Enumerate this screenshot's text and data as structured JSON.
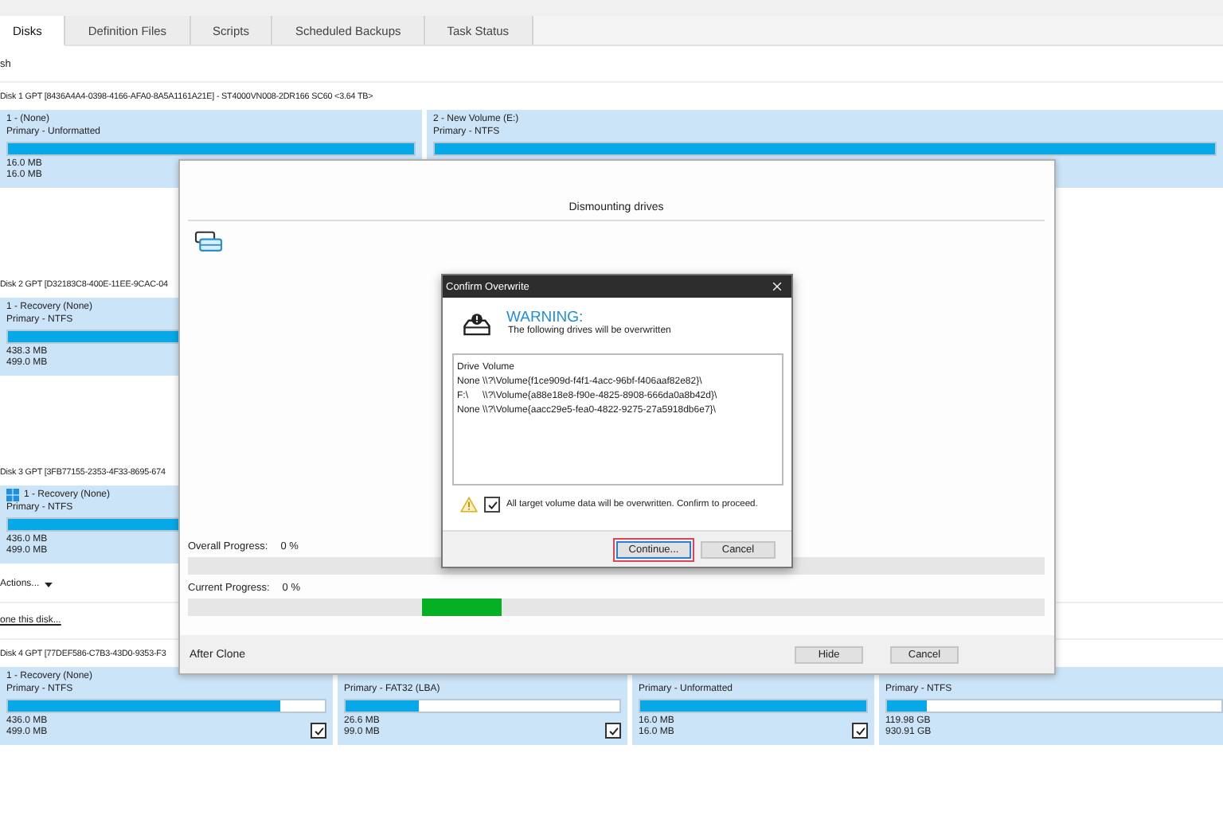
{
  "tabs": [
    {
      "label": "Disks",
      "selected": true
    },
    {
      "label": "Definition Files",
      "selected": false
    },
    {
      "label": "Scripts",
      "selected": false
    },
    {
      "label": "Scheduled Backups",
      "selected": false
    },
    {
      "label": "Task Status",
      "selected": false
    }
  ],
  "toolbar": {
    "refresh": "sh"
  },
  "disks": [
    {
      "header": "Disk 1 GPT [8436A4A4-0398-4166-AFA0-8A5A1161A21E] - ST4000VN008-2DR166 SC60  <3.64 TB>",
      "partitions": [
        {
          "name": "1 - (None)",
          "type": "Primary - Unformatted",
          "level": 1,
          "used": "16.0 MB",
          "total": "16.0 MB"
        },
        {
          "name": "2 - New Volume (E:)",
          "type": "Primary - NTFS",
          "level": 1
        }
      ]
    },
    {
      "header": "Disk 2 GPT [D32183C8-400E-11EE-9CAC-04",
      "partitions": [
        {
          "name": "1 - Recovery (None)",
          "type": "Primary - NTFS",
          "level": 0.88,
          "used": "438.3 MB",
          "total": "499.0 MB"
        }
      ]
    },
    {
      "header": "Disk 3 GPT [3FB77155-2353-4F33-8695-674",
      "partitions": [
        {
          "name": "1 - Recovery (None)",
          "system": true,
          "type": "Primary - NTFS",
          "level": 0.87,
          "used": "436.0 MB",
          "total": "499.0 MB"
        }
      ],
      "actions": "Actions...",
      "clone_link": "one this disk..."
    },
    {
      "header": "Disk 4 GPT [77DEF586-C7B3-43D0-9353-F3",
      "partitions": [
        {
          "name": "1 - Recovery (None)",
          "type": "Primary - NTFS",
          "level": 0.86,
          "used": "436.0 MB",
          "total": "499.0 MB",
          "checked": true
        },
        {
          "type": "Primary - FAT32 (LBA)",
          "level": 0.27,
          "used": "26.6 MB",
          "total": "99.0 MB",
          "checked": true
        },
        {
          "type": "Primary - Unformatted",
          "level": 1,
          "used": "16.0 MB",
          "total": "16.0 MB",
          "checked": true
        },
        {
          "type": "Primary - NTFS",
          "level": 0.12,
          "used": "119.98 GB",
          "total": "930.91 GB"
        }
      ]
    }
  ],
  "progress_dialog": {
    "heading": "Dismounting drives",
    "overall": {
      "label": "Overall Progress:",
      "value": "0 %",
      "level": 0
    },
    "current": {
      "label": "Current Progress:",
      "value": "0 %"
    },
    "after_clone": "After Clone",
    "buttons": [
      "Hide",
      "Cancel"
    ]
  },
  "confirm_dialog": {
    "title": "Confirm Overwrite",
    "warning": "WARNING:",
    "message": "The following drives will be overwritten",
    "columns": [
      "Drive",
      "Volume"
    ],
    "rows": [
      [
        "None",
        "\\\\?\\Volume{f1ce909d-f4f1-4acc-96bf-f406aaf82e82}\\"
      ],
      [
        "F:\\",
        "\\\\?\\Volume{a88e18e8-f90e-4825-8908-666da0a8b42d}\\"
      ],
      [
        "None",
        "\\\\?\\Volume{aacc29e5-fea0-4822-9275-27a5918db6e7}\\"
      ]
    ],
    "confirm_text": "All target volume data will be overwritten. Confirm to proceed.",
    "confirm_checked": true,
    "buttons": [
      {
        "label": "Continue...",
        "focused": true
      },
      {
        "label": "Cancel",
        "focused": false
      }
    ]
  }
}
